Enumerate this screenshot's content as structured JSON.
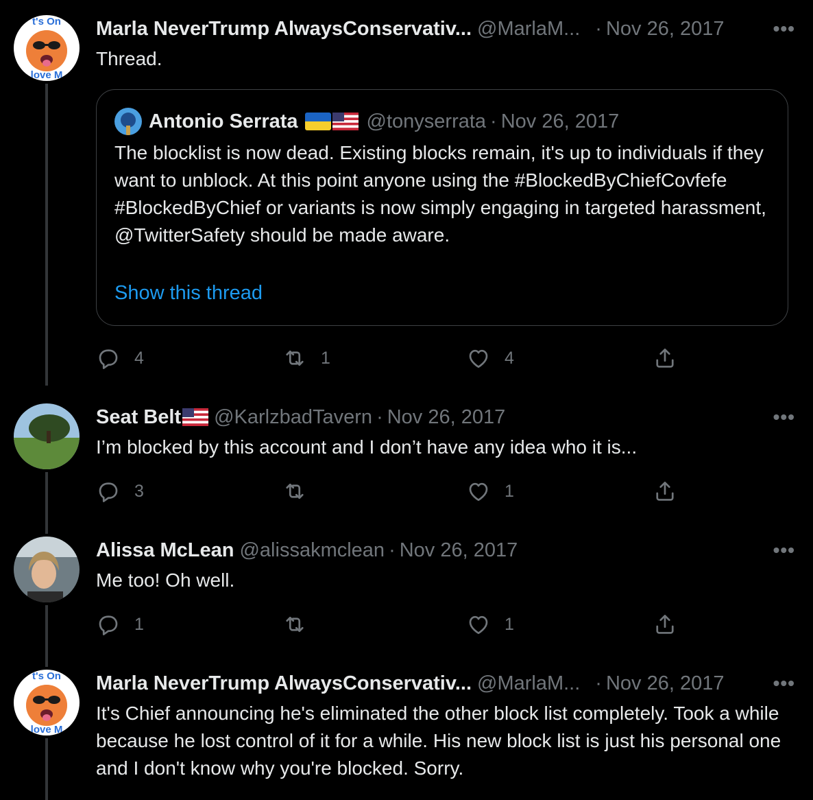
{
  "tweets": [
    {
      "name": "Marla NeverTrump AlwaysConservativ...",
      "handle": "@MarlaM...",
      "date": "Nov 26, 2017",
      "text": "Thread.",
      "avatar_lettering": [
        "t's On",
        "love M"
      ],
      "quote": {
        "name": "Antonio Serrata",
        "handle": "@tonyserrata",
        "date": "Nov 26, 2017",
        "text": "The blocklist is now dead. Existing blocks remain, it's up to individuals if they want to unblock. At this point anyone using the #BlockedByChiefCovfefe #BlockedByChief or variants is now simply engaging in targeted harassment, @TwitterSafety should be made aware.",
        "link": "Show this thread",
        "flags": [
          "ukraine-flag",
          "us-flag"
        ]
      },
      "replies": "4",
      "retweets": "1",
      "likes": "4"
    },
    {
      "name": "Seat Belt",
      "handle": "@KarlzbadTavern",
      "date": "Nov 26, 2017",
      "text": "I’m blocked by this account and I don’t have any idea who it is...",
      "flags": [
        "us-flag"
      ],
      "replies": "3",
      "retweets": "",
      "likes": "1"
    },
    {
      "name": "Alissa McLean",
      "handle": "@alissakmclean",
      "date": "Nov 26, 2017",
      "text": "Me too! Oh well.",
      "replies": "1",
      "retweets": "",
      "likes": "1"
    },
    {
      "name": "Marla NeverTrump AlwaysConservativ...",
      "handle": "@MarlaM...",
      "date": "Nov 26, 2017",
      "text": "It's Chief announcing he's eliminated the other block list completely. Took a while because he lost control of it for a while. His new block list is just his personal one and I don't know why you're blocked. Sorry."
    }
  ],
  "ui": {
    "separator": "·",
    "more": "•••"
  },
  "colors": {
    "background": "#000000",
    "text": "#e7e9ea",
    "muted": "#71767b",
    "link": "#1d9bf0",
    "border": "#3e4144",
    "thread_line": "#333639"
  }
}
